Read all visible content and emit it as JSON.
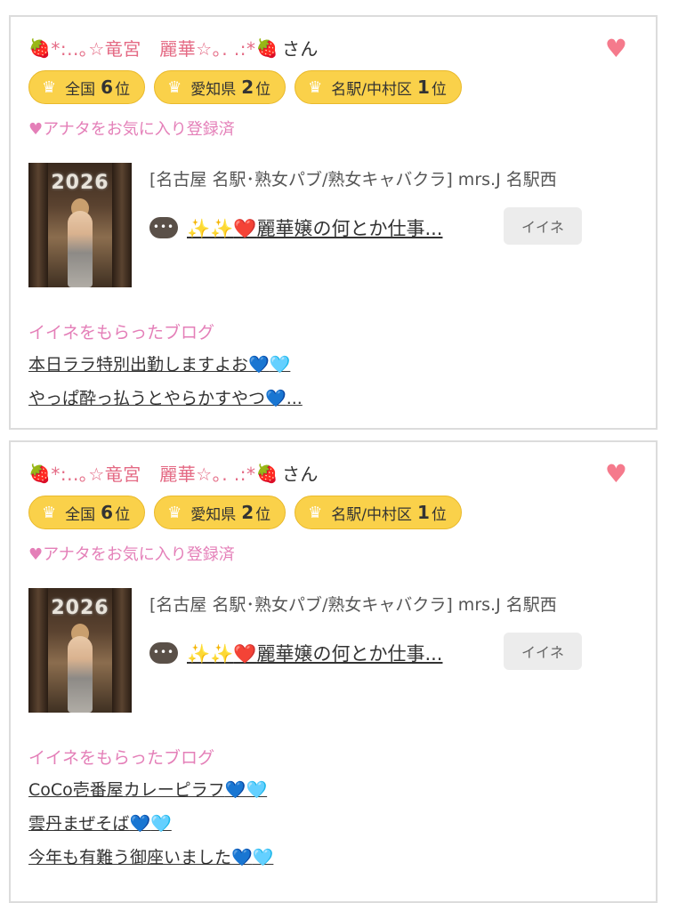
{
  "cards": [
    {
      "user_name": "*:..｡☆竜宮　麗華☆｡. .:*",
      "honorific": "さん",
      "ranks": [
        {
          "area": "全国",
          "rank": "6",
          "unit": "位"
        },
        {
          "area": "愛知県",
          "rank": "2",
          "unit": "位"
        },
        {
          "area": "名駅/中村区",
          "rank": "1",
          "unit": "位"
        }
      ],
      "favorite_note": "♥アナタをお気に入り登録済",
      "shop": "[名古屋 名駅･熟女パブ/熟女キャバクラ]  mrs.J 名駅西",
      "thumb_text": "2026",
      "post_title": "麗華嬢の何とか仕事...",
      "iine_label": "イイネ",
      "bubble_text": "•••",
      "blog_heading": "イイネをもらったブログ",
      "blogs": [
        "本日ララ特別出勤しますよお",
        "やっぱ酔っ払うとやらかすやつ"
      ],
      "blog_suffix_1": "",
      "blog_suffix_2": "..."
    },
    {
      "user_name": "*:..｡☆竜宮　麗華☆｡. .:*",
      "honorific": "さん",
      "ranks": [
        {
          "area": "全国",
          "rank": "6",
          "unit": "位"
        },
        {
          "area": "愛知県",
          "rank": "2",
          "unit": "位"
        },
        {
          "area": "名駅/中村区",
          "rank": "1",
          "unit": "位"
        }
      ],
      "favorite_note": "♥アナタをお気に入り登録済",
      "shop": "[名古屋 名駅･熟女パブ/熟女キャバクラ]  mrs.J 名駅西",
      "thumb_text": "2026",
      "post_title": "麗華嬢の何とか仕事...",
      "iine_label": "イイネ",
      "bubble_text": "•••",
      "blog_heading": "イイネをもらったブログ",
      "blogs": [
        "CoCo壱番屋カレーピラフ",
        "雲丹まぜそば",
        "今年も有難う御座いました"
      ]
    }
  ],
  "colors": {
    "accent_pink": "#e47fb8",
    "name_pink": "#e46a84",
    "badge_yellow": "#fad14a",
    "fav_heart": "#f57a8c"
  },
  "icons": {
    "strawberry": "strawberry-icon",
    "crown": "crown-icon",
    "heart": "heart-icon",
    "comment": "comment-bubble-icon"
  }
}
